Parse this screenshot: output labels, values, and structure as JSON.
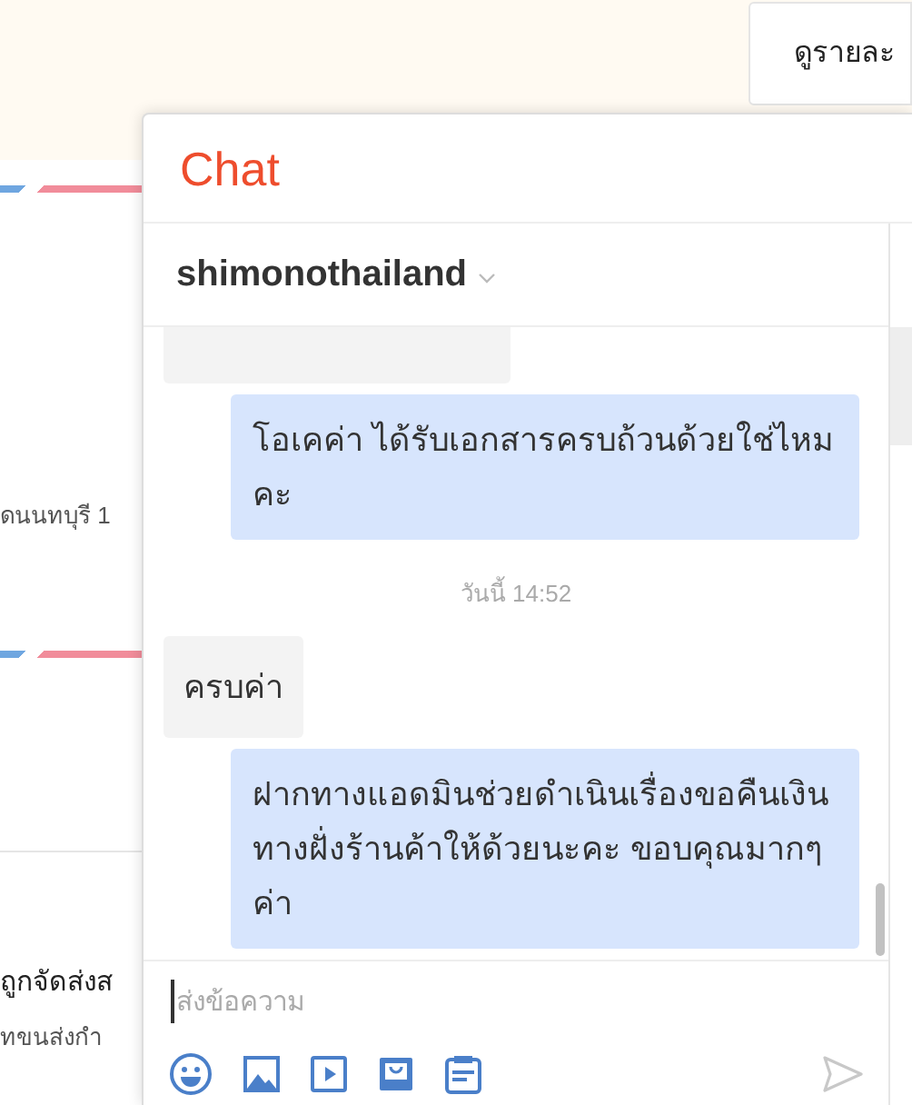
{
  "page": {
    "details_button": "ดูรายละ",
    "address_text": "ดนนทบุรี 1",
    "status_text": "ถูกจัดส่งส",
    "shipping_text": "ทขนส่งกำ"
  },
  "chat": {
    "title": "Chat",
    "contact": "shimonothailand",
    "messages": [
      {
        "kind": "partial",
        "sent": false
      },
      {
        "kind": "message",
        "sent": true,
        "text": "โอเคค่า ได้รับเอกสารครบถ้วนด้วยใช่ไหมคะ"
      },
      {
        "kind": "time",
        "text": "วันนี้ 14:52"
      },
      {
        "kind": "message",
        "sent": false,
        "text": "ครบค่า"
      },
      {
        "kind": "message",
        "sent": true,
        "text": "ฝากทางแอดมินช่วยดำเนินเรื่องขอคืนเงินทางฝั่งร้านค้าให้ด้วยนะคะ ขอบคุณมากๆ ค่า"
      }
    ],
    "input": {
      "placeholder": "ส่งข้อความ"
    }
  }
}
